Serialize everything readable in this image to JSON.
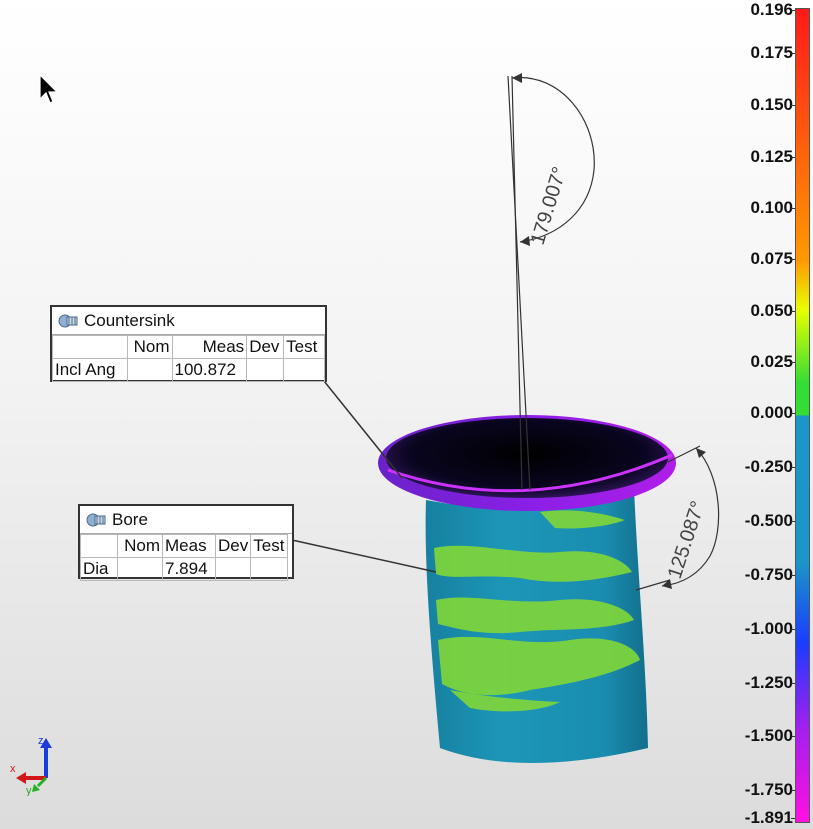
{
  "color_scale": {
    "labels": [
      "0.196",
      "0.175",
      "0.150",
      "0.125",
      "0.100",
      "0.075",
      "0.050",
      "0.025",
      "0.000",
      "-0.250",
      "-0.500",
      "-0.750",
      "-1.000",
      "-1.250",
      "-1.500",
      "-1.750",
      "-1.891"
    ],
    "colors": {
      "top": "#ff1a1a",
      "orange": "#ff9900",
      "yellow": "#e8ff00",
      "green": "#33dd33",
      "teal": "#1a96c8",
      "blue": "#1a3cff",
      "purple": "#a020f0",
      "magenta": "#ff10e0"
    }
  },
  "callouts": {
    "countersink": {
      "title": "Countersink",
      "icon": "dimension-icon",
      "headers": [
        "",
        "Nom",
        "Meas",
        "Dev",
        "Test"
      ],
      "row": {
        "label": "Incl Ang",
        "nom": "",
        "meas": "100.872",
        "dev": "",
        "test": ""
      }
    },
    "bore": {
      "title": "Bore",
      "icon": "dimension-icon",
      "headers": [
        "",
        "Nom",
        "Meas",
        "Dev",
        "Test"
      ],
      "row": {
        "label": "Dia",
        "nom": "",
        "meas": "7.894",
        "dev": "",
        "test": ""
      }
    }
  },
  "angle_annotations": {
    "top": "179.007°",
    "side": "125.087°"
  },
  "axes": {
    "x": "x",
    "y": "y",
    "z": "z"
  }
}
